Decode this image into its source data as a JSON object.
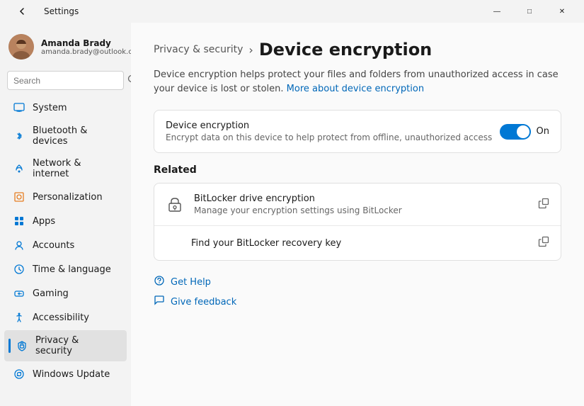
{
  "titleBar": {
    "title": "Settings",
    "backArrow": "←",
    "minBtn": "—",
    "maxBtn": "□",
    "closeBtn": "✕"
  },
  "user": {
    "name": "Amanda Brady",
    "email": "amanda.brady@outlook.com"
  },
  "search": {
    "placeholder": "Search"
  },
  "nav": {
    "items": [
      {
        "id": "system",
        "label": "System",
        "icon": "system"
      },
      {
        "id": "bluetooth",
        "label": "Bluetooth & devices",
        "icon": "bluetooth"
      },
      {
        "id": "network",
        "label": "Network & internet",
        "icon": "network"
      },
      {
        "id": "personalization",
        "label": "Personalization",
        "icon": "personalization"
      },
      {
        "id": "apps",
        "label": "Apps",
        "icon": "apps"
      },
      {
        "id": "accounts",
        "label": "Accounts",
        "icon": "accounts"
      },
      {
        "id": "time",
        "label": "Time & language",
        "icon": "time"
      },
      {
        "id": "gaming",
        "label": "Gaming",
        "icon": "gaming"
      },
      {
        "id": "accessibility",
        "label": "Accessibility",
        "icon": "accessibility"
      },
      {
        "id": "privacy",
        "label": "Privacy & security",
        "icon": "privacy",
        "active": true
      },
      {
        "id": "windows-update",
        "label": "Windows Update",
        "icon": "update"
      }
    ]
  },
  "breadcrumb": {
    "parent": "Privacy & security",
    "arrow": "›",
    "current": "Device encryption"
  },
  "description": {
    "text": "Device encryption helps protect your files and folders from unauthorized access in case your device is lost or stolen.",
    "linkText": "More about device encryption"
  },
  "deviceEncryption": {
    "title": "Device encryption",
    "desc": "Encrypt data on this device to help protect from offline, unauthorized access",
    "toggleLabel": "On",
    "enabled": true
  },
  "related": {
    "sectionTitle": "Related",
    "items": [
      {
        "id": "bitlocker",
        "title": "BitLocker drive encryption",
        "desc": "Manage your encryption settings using BitLocker",
        "hasIcon": true
      },
      {
        "id": "recovery-key",
        "title": "Find your BitLocker recovery key",
        "desc": "",
        "hasIcon": false
      }
    ]
  },
  "help": {
    "getHelp": "Get Help",
    "giveFeedback": "Give feedback"
  },
  "colors": {
    "accent": "#0078d4",
    "link": "#0067b8"
  }
}
